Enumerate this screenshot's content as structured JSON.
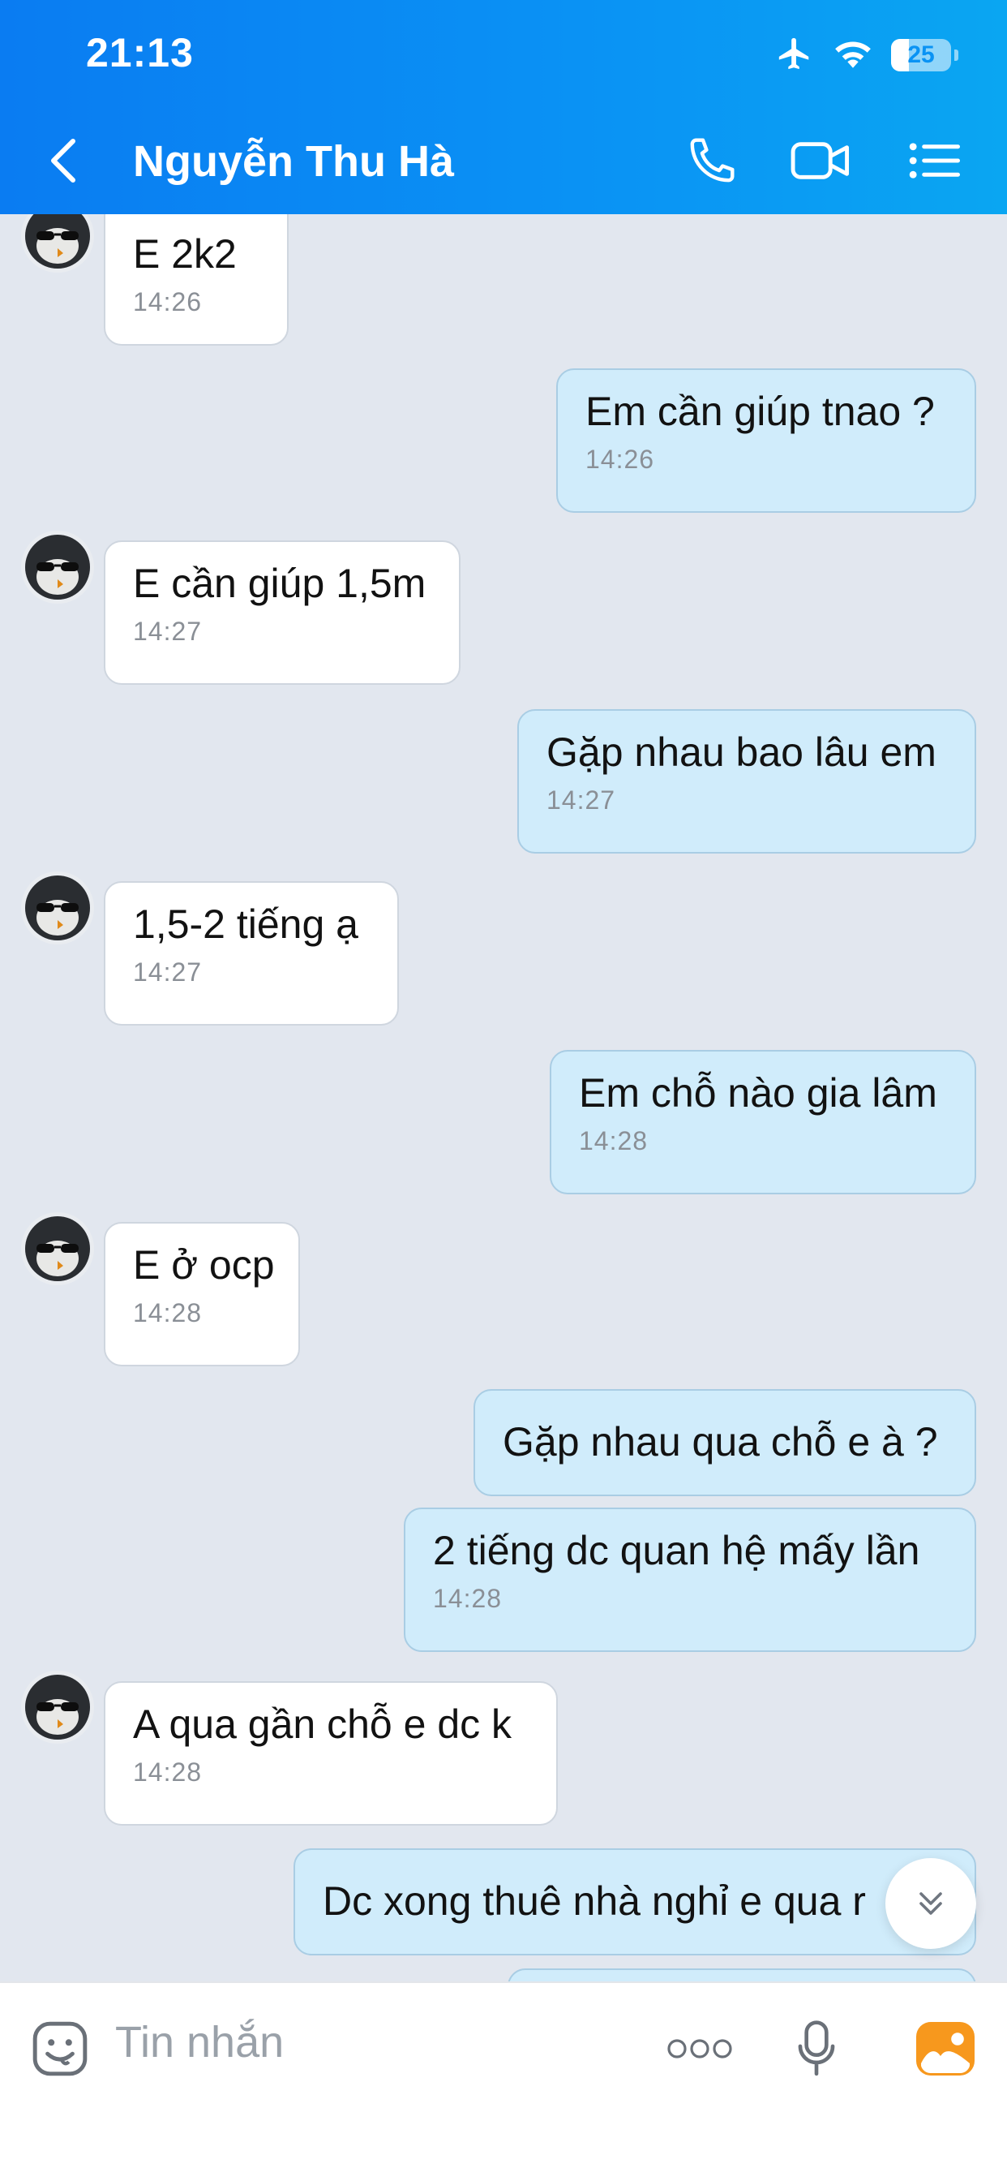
{
  "status_bar": {
    "time": "21:13",
    "battery": "25"
  },
  "header": {
    "contact_name": "Nguyễn Thu Hà"
  },
  "messages": [
    {
      "dir": "in",
      "text": "E 2k2",
      "time": "14:26"
    },
    {
      "dir": "out",
      "text": "Em cần giúp tnao ?",
      "time": "14:26"
    },
    {
      "dir": "in",
      "text": "E cần giúp 1,5m",
      "time": "14:27"
    },
    {
      "dir": "out",
      "text": "Gặp nhau bao lâu em",
      "time": "14:27"
    },
    {
      "dir": "in",
      "text": "1,5-2 tiếng ạ",
      "time": "14:27"
    },
    {
      "dir": "out",
      "text": "Em chỗ nào gia lâm",
      "time": "14:28"
    },
    {
      "dir": "in",
      "text": "E ở ocp",
      "time": "14:28"
    },
    {
      "dir": "out",
      "text": "Gặp nhau qua chỗ e à ?",
      "time": ""
    },
    {
      "dir": "out",
      "text": "2 tiếng dc quan hệ mấy lần",
      "time": "14:28"
    },
    {
      "dir": "in",
      "text": "A qua gần chỗ e dc k",
      "time": "14:28"
    },
    {
      "dir": "out",
      "text": "Dc xong thuê nhà nghỉ e qua r",
      "time": ""
    }
  ],
  "input": {
    "placeholder": "Tin nhắn"
  },
  "colors": {
    "header_start": "#0a7cf2",
    "header_end": "#0aa6f2",
    "outgoing_bubble": "#d0ecfb",
    "incoming_bubble": "#ffffff",
    "chat_bg": "#e2e7ef"
  },
  "icons": [
    "back-icon",
    "phone-icon",
    "video-call-icon",
    "menu-list-icon",
    "emoji-icon",
    "more-icon",
    "microphone-icon",
    "gallery-icon",
    "chevron-double-down-icon",
    "airplane-icon",
    "wifi-icon",
    "battery-icon"
  ]
}
